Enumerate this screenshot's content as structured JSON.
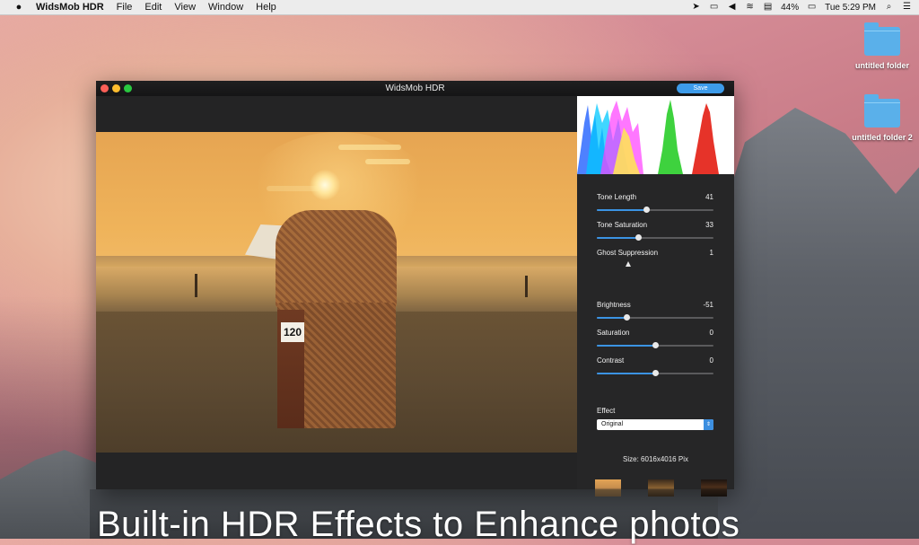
{
  "menubar": {
    "app_name": "WidsMob HDR",
    "items": [
      "File",
      "Edit",
      "View",
      "Window",
      "Help"
    ],
    "battery": "44%",
    "clock": "Tue 5:29 PM"
  },
  "desktop": {
    "icons": [
      {
        "label": "untitled folder"
      },
      {
        "label": "untitled folder 2"
      }
    ]
  },
  "window": {
    "title": "WidsMob HDR",
    "save_label": "Save"
  },
  "photo": {
    "chair_number": "120"
  },
  "panel": {
    "sliders": [
      {
        "label": "Tone Length",
        "value": "41",
        "fraction": 0.42
      },
      {
        "label": "Tone Saturation",
        "value": "33",
        "fraction": 0.35
      },
      {
        "label": "Ghost Suppression",
        "value": "1",
        "fraction": 0.27
      },
      {
        "label": "Brightness",
        "value": "-51",
        "fraction": 0.25
      },
      {
        "label": "Saturation",
        "value": "0",
        "fraction": 0.5
      },
      {
        "label": "Contrast",
        "value": "0",
        "fraction": 0.5
      }
    ],
    "effect_label": "Effect",
    "effect_value": "Original",
    "size_text": "Size: 6016x4016 Pix"
  },
  "caption": "Built-in HDR Effects to Enhance photos",
  "colors": {
    "accent": "#3b93e3",
    "window_bg": "#2b2b2c",
    "panel_bg": "#262627"
  }
}
